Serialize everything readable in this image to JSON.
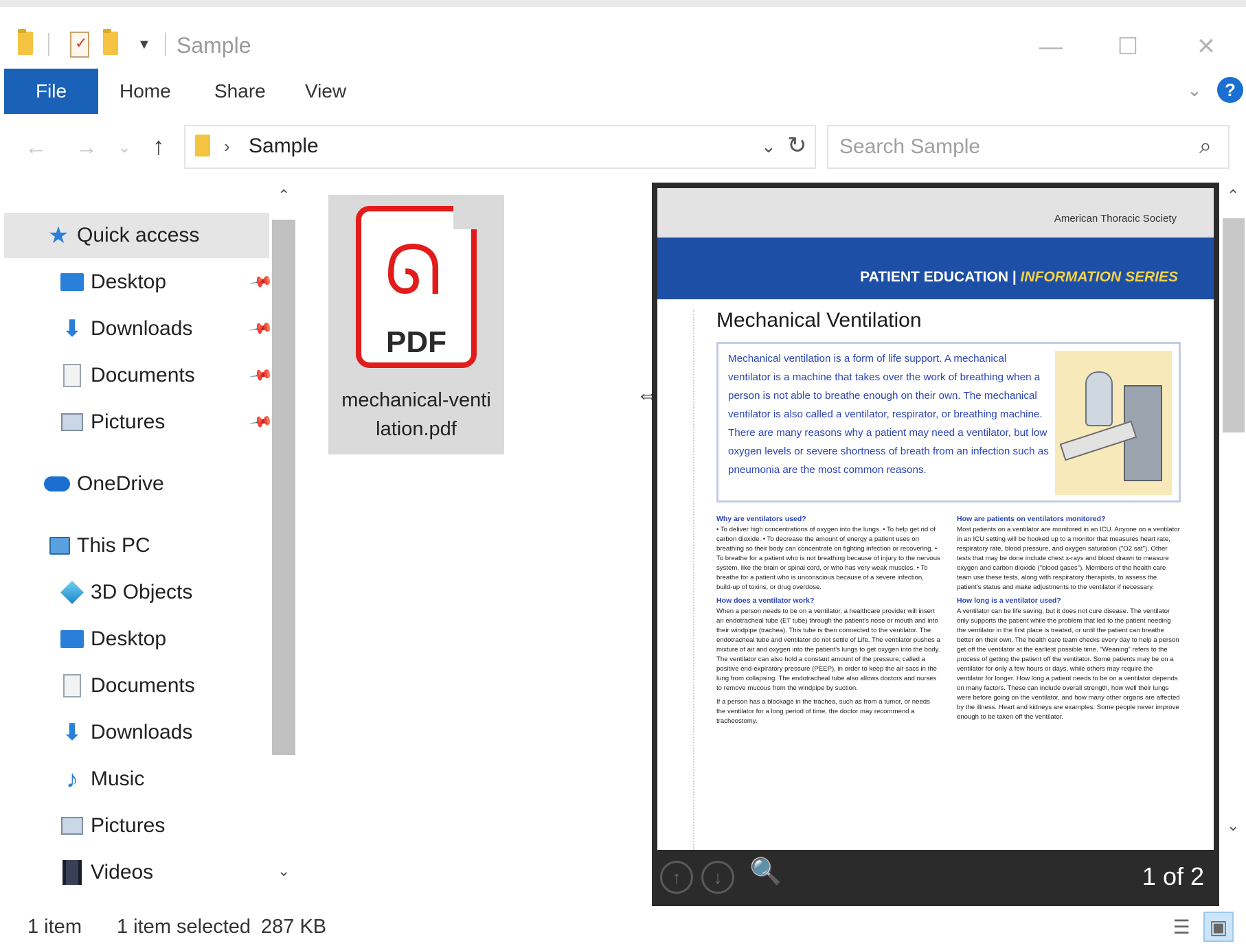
{
  "window": {
    "title": "Sample",
    "minimize": "—",
    "maximize": "☐",
    "close": "✕"
  },
  "ribbon": {
    "tabs": [
      "File",
      "Home",
      "Share",
      "View"
    ],
    "help": "?"
  },
  "address": {
    "path": "Sample",
    "arrow": "›",
    "dropdown": "⌄",
    "refresh": "↻"
  },
  "search": {
    "placeholder": "Search Sample"
  },
  "nav": {
    "back": "←",
    "forward": "→",
    "recent": "⌄",
    "up": "↑"
  },
  "navpane": {
    "quick_access": "Quick access",
    "quick_items": [
      {
        "label": "Desktop",
        "icon": "desktop-icon"
      },
      {
        "label": "Downloads",
        "icon": "downloads-icon"
      },
      {
        "label": "Documents",
        "icon": "documents-icon"
      },
      {
        "label": "Pictures",
        "icon": "pictures-icon"
      }
    ],
    "onedrive": "OneDrive",
    "this_pc": "This PC",
    "pc_items": [
      {
        "label": "3D Objects",
        "icon": "3d-objects-icon"
      },
      {
        "label": "Desktop",
        "icon": "desktop-icon"
      },
      {
        "label": "Documents",
        "icon": "documents-icon"
      },
      {
        "label": "Downloads",
        "icon": "downloads-icon"
      },
      {
        "label": "Music",
        "icon": "music-icon"
      },
      {
        "label": "Pictures",
        "icon": "pictures-icon"
      },
      {
        "label": "Videos",
        "icon": "videos-icon"
      }
    ]
  },
  "file": {
    "icon_label": "PDF",
    "name": "mechanical-ventilation.pdf",
    "name_line1": "mechanical-venti",
    "name_line2": "lation.pdf"
  },
  "preview": {
    "society": "American Thoracic Society",
    "banner_a": "PATIENT EDUCATION | ",
    "banner_b": "INFORMATION SERIES",
    "heading": "Mechanical Ventilation",
    "intro": "Mechanical ventilation is a form of life support. A mechanical ventilator is a machine that takes over the work of breathing when a person is not able to breathe enough on their own. The mechanical ventilator is also called a ventilator, respirator, or breathing machine. There are many reasons why a patient may need a ventilator, but low oxygen levels or severe shortness of breath from an infection such as pneumonia are the most common reasons.",
    "left_col": [
      {
        "h": "Why are ventilators used?",
        "p": "• To deliver high concentrations of oxygen into the lungs. • To help get rid of carbon dioxide. • To decrease the amount of energy a patient uses on breathing so their body can concentrate on fighting infection or recovering. • To breathe for a patient who is not breathing because of injury to the nervous system, like the brain or spinal cord, or who has very weak muscles. • To breathe for a patient who is unconscious because of a severe infection, build-up of toxins, or drug overdose."
      },
      {
        "h": "How does a ventilator work?",
        "p": "When a person needs to be on a ventilator, a healthcare provider will insert an endotracheal tube (ET tube) through the patient's nose or mouth and into their windpipe (trachea). This tube is then connected to the ventilator. The endotracheal tube and ventilator do not settle of Life. The ventilator pushes a mixture of air and oxygen into the patient's lungs to get oxygen into the body. The ventilator can also hold a constant amount of the pressure, called a positive end-expiratory pressure (PEEP), in order to keep the air sacs in the lung from collapsing. The endotracheal tube also allows doctors and nurses to remove mucous from the windpipe by suction."
      },
      {
        "h": "",
        "p": "If a person has a blockage in the trachea, such as from a tumor, or needs the ventilator for a long period of time, the doctor may recommend a tracheostomy."
      }
    ],
    "right_col": [
      {
        "h": "How are patients on ventilators monitored?",
        "p": "Most patients on a ventilator are monitored in an ICU. Anyone on a ventilator in an ICU setting will be hooked up to a monitor that measures heart rate, respiratory rate, blood pressure, and oxygen saturation (\"O2 sat\"). Other tests that may be done include chest x-rays and blood drawn to measure oxygen and carbon dioxide (\"blood gases\"). Members of the health care team use these tests, along with respiratory therapists, to assess the patient's status and make adjustments to the ventilator if necessary."
      },
      {
        "h": "How long is a ventilator used?",
        "p": "A ventilator can be life saving, but it does not cure disease. The ventilator only supports the patient while the problem that led to the patient needing the ventilator in the first place is treated, or until the patient can breathe better on their own. The health care team checks every day to help a person get off the ventilator at the earliest possible time. \"Weaning\" refers to the process of getting the patient off the ventilator. Some patients may be on a ventilator for only a few hours or days, while others may require the ventilator for longer. How long a patient needs to be on a ventilator depends on many factors. These can include overall strength, how well their lungs were before going on the ventilator, and how many other organs are affected by the illness. Heart and kidneys are examples. Some people never improve enough to be taken off the ventilator."
      }
    ],
    "page_count": "1 of 2"
  },
  "status": {
    "items": "1 item",
    "selected": "1 item selected",
    "size": "287 KB"
  }
}
